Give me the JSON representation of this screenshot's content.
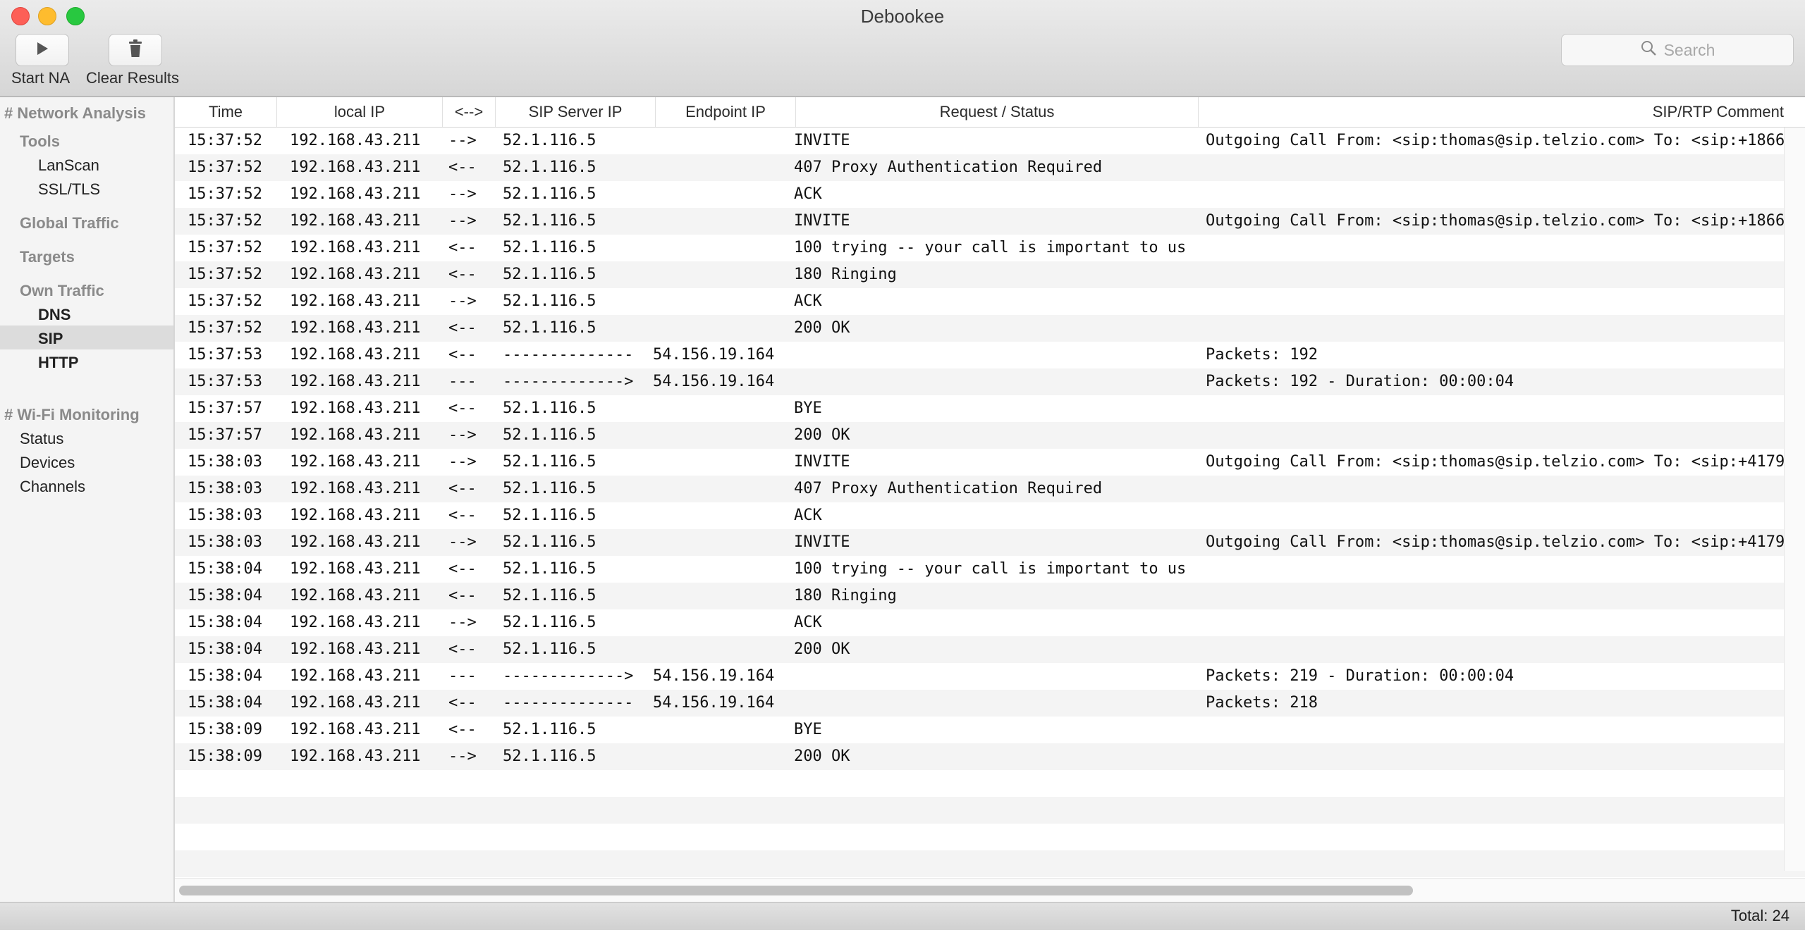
{
  "window": {
    "title": "Debookee"
  },
  "toolbar": {
    "start_label": "Start NA",
    "clear_label": "Clear Results",
    "search_placeholder": "Search"
  },
  "sidebar": {
    "network_analysis": "# Network Analysis",
    "tools": "Tools",
    "lanscan": "LanScan",
    "ssl": "SSL/TLS",
    "global_traffic": "Global Traffic",
    "targets": "Targets",
    "own_traffic": "Own Traffic",
    "dns": "DNS",
    "sip": "SIP",
    "http": "HTTP",
    "wifi": "# Wi-Fi Monitoring",
    "status": "Status",
    "devices": "Devices",
    "channels": "Channels",
    "selected": "SIP"
  },
  "table": {
    "columns": [
      "Time",
      "local IP",
      "<-->",
      "SIP Server IP",
      "Endpoint IP",
      "Request / Status",
      "SIP/RTP Comment"
    ],
    "rows": [
      [
        "15:37:52",
        "192.168.43.211",
        "-->",
        "52.1.116.5",
        "",
        "INVITE",
        "Outgoing Call From: <sip:thomas@sip.telzio.com> To: <sip:+1866"
      ],
      [
        "15:37:52",
        "192.168.43.211",
        "<--",
        "52.1.116.5",
        "",
        "407 Proxy Authentication Required",
        ""
      ],
      [
        "15:37:52",
        "192.168.43.211",
        "-->",
        "52.1.116.5",
        "",
        "ACK",
        ""
      ],
      [
        "15:37:52",
        "192.168.43.211",
        "-->",
        "52.1.116.5",
        "",
        "INVITE",
        "Outgoing Call From: <sip:thomas@sip.telzio.com> To: <sip:+1866"
      ],
      [
        "15:37:52",
        "192.168.43.211",
        "<--",
        "52.1.116.5",
        "",
        "100 trying -- your call is important to us",
        ""
      ],
      [
        "15:37:52",
        "192.168.43.211",
        "<--",
        "52.1.116.5",
        "",
        "180 Ringing",
        ""
      ],
      [
        "15:37:52",
        "192.168.43.211",
        "-->",
        "52.1.116.5",
        "",
        "ACK",
        ""
      ],
      [
        "15:37:52",
        "192.168.43.211",
        "<--",
        "52.1.116.5",
        "",
        "200 OK",
        ""
      ],
      [
        "15:37:53",
        "192.168.43.211",
        "<--",
        "--------------",
        "54.156.19.164",
        "",
        "Packets: 192"
      ],
      [
        "15:37:53",
        "192.168.43.211",
        "---",
        "------------->",
        "54.156.19.164",
        "",
        "Packets: 192 - Duration: 00:00:04"
      ],
      [
        "15:37:57",
        "192.168.43.211",
        "<--",
        "52.1.116.5",
        "",
        "BYE",
        ""
      ],
      [
        "15:37:57",
        "192.168.43.211",
        "-->",
        "52.1.116.5",
        "",
        "200 OK",
        ""
      ],
      [
        "15:38:03",
        "192.168.43.211",
        "-->",
        "52.1.116.5",
        "",
        "INVITE",
        "Outgoing Call From: <sip:thomas@sip.telzio.com> To: <sip:+4179"
      ],
      [
        "15:38:03",
        "192.168.43.211",
        "<--",
        "52.1.116.5",
        "",
        "407 Proxy Authentication Required",
        ""
      ],
      [
        "15:38:03",
        "192.168.43.211",
        "<--",
        "52.1.116.5",
        "",
        "ACK",
        ""
      ],
      [
        "15:38:03",
        "192.168.43.211",
        "-->",
        "52.1.116.5",
        "",
        "INVITE",
        "Outgoing Call From: <sip:thomas@sip.telzio.com> To: <sip:+4179"
      ],
      [
        "15:38:04",
        "192.168.43.211",
        "<--",
        "52.1.116.5",
        "",
        "100 trying -- your call is important to us",
        ""
      ],
      [
        "15:38:04",
        "192.168.43.211",
        "<--",
        "52.1.116.5",
        "",
        "180 Ringing",
        ""
      ],
      [
        "15:38:04",
        "192.168.43.211",
        "-->",
        "52.1.116.5",
        "",
        "ACK",
        ""
      ],
      [
        "15:38:04",
        "192.168.43.211",
        "<--",
        "52.1.116.5",
        "",
        "200 OK",
        ""
      ],
      [
        "15:38:04",
        "192.168.43.211",
        "---",
        "------------->",
        "54.156.19.164",
        "",
        "Packets: 219 - Duration: 00:00:04"
      ],
      [
        "15:38:04",
        "192.168.43.211",
        "<--",
        "--------------",
        "54.156.19.164",
        "",
        "Packets: 218"
      ],
      [
        "15:38:09",
        "192.168.43.211",
        "<--",
        "52.1.116.5",
        "",
        "BYE",
        ""
      ],
      [
        "15:38:09",
        "192.168.43.211",
        "-->",
        "52.1.116.5",
        "",
        "200 OK",
        ""
      ]
    ]
  },
  "status": {
    "total": "Total: 24"
  }
}
